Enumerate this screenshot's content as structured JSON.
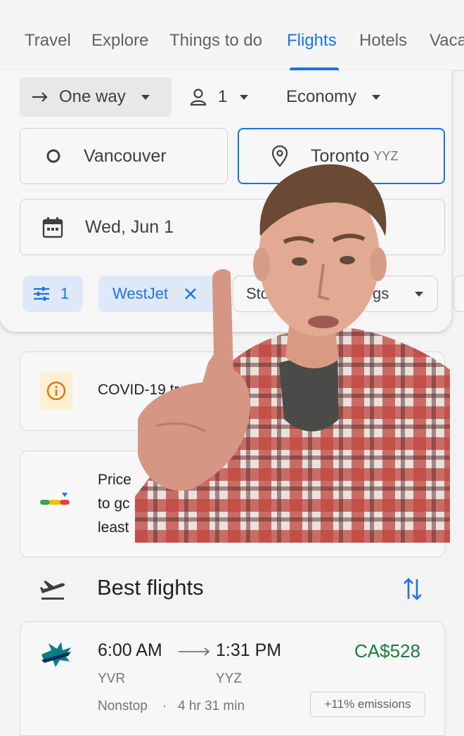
{
  "nav": {
    "tabs": [
      {
        "label": "Travel"
      },
      {
        "label": "Explore"
      },
      {
        "label": "Things to do"
      },
      {
        "label": "Flights"
      },
      {
        "label": "Hotels"
      },
      {
        "label": "Vaca"
      }
    ],
    "active_tab": "Flights"
  },
  "search": {
    "trip_type": "One way",
    "passengers": "1",
    "cabin": "Economy",
    "origin": "Vancouver",
    "destination": "Toronto",
    "destination_code": "YYZ",
    "date": "Wed, Jun 1",
    "filters": {
      "all_filters_count": "1",
      "airline_chip": "WestJet",
      "stops_chip": "Stop",
      "bags_chip": "gs"
    }
  },
  "covid_card": {
    "text": "COVID-19 tr"
  },
  "price_card": {
    "lines": [
      "Price",
      "to gc      in th",
      "least    A$55"
    ]
  },
  "best_flights": {
    "title": "Best flights",
    "flight": {
      "depart_time": "6:00 AM",
      "arrive_time": "1:31 PM",
      "origin_code": "YVR",
      "dest_code": "YYZ",
      "stops": "Nonstop",
      "separator": "·",
      "duration": "4 hr 31 min",
      "price": "CA$528",
      "emissions": "+11% emissions"
    }
  },
  "colors": {
    "accent": "#1a73e8",
    "price_green": "#188038",
    "chip_bg": "#dfe8f8"
  }
}
